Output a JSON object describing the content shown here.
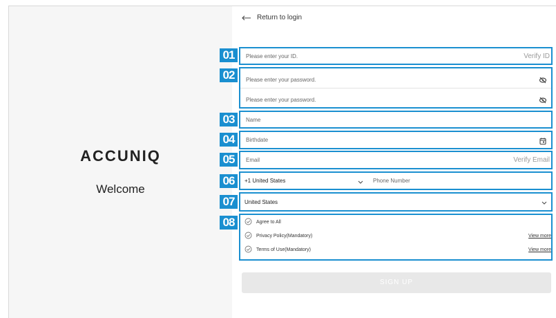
{
  "brand": {
    "logo": "ACCUNIQ",
    "welcome": "Welcome"
  },
  "nav": {
    "back_label": "Return to login"
  },
  "badges": [
    "01",
    "02",
    "03",
    "04",
    "05",
    "06",
    "07",
    "08"
  ],
  "form": {
    "id_placeholder": "Please enter your ID.",
    "verify_id": "Verify ID",
    "password_placeholder": "Please enter your password.",
    "password_confirm_placeholder": "Please enter your password.",
    "name_placeholder": "Name",
    "birthdate_placeholder": "Birthdate",
    "email_placeholder": "Email",
    "verify_email": "Verify Email",
    "country_code": "+1 United States",
    "phone_placeholder": "Phone Number",
    "country": "United States"
  },
  "agreements": {
    "all": "Agree to All",
    "privacy": "Privacy Policy(Mandatory)",
    "terms": "Terms of Use(Mandatory)",
    "view_more": "View more"
  },
  "signup_label": "SIGN UP",
  "colors": {
    "accent": "#1a8fd0",
    "panel": "#f6f6f6",
    "button_disabled": "#e8e8e8"
  },
  "icons": {
    "back": "arrow-left-icon",
    "eye": "eye-off-icon",
    "calendar": "calendar-icon",
    "chevron": "chevron-down-icon",
    "check": "check-circle-icon"
  }
}
